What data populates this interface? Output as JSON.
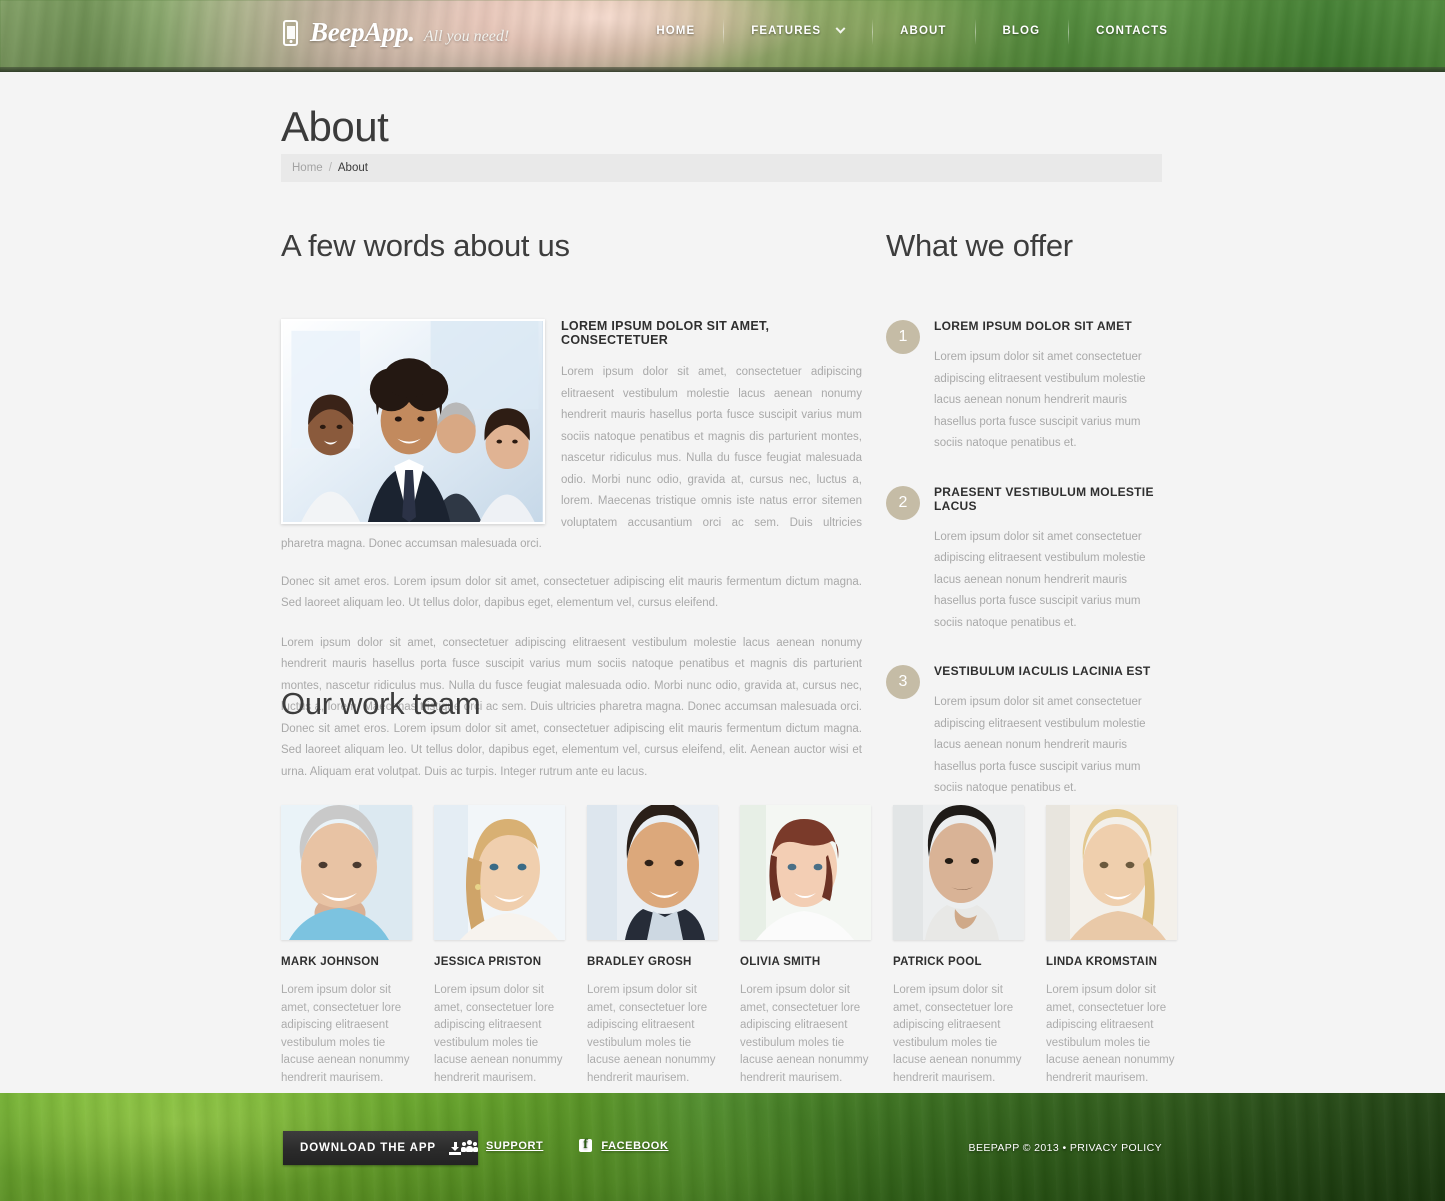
{
  "header": {
    "logo_name": "BeepApp.",
    "logo_tagline": "All you need!",
    "logo_icon": "smartphone-icon",
    "nav": [
      {
        "label": "HOME",
        "has_dropdown": false
      },
      {
        "label": "FEATURES",
        "has_dropdown": true
      },
      {
        "label": "ABOUT",
        "has_dropdown": false
      },
      {
        "label": "BLOG",
        "has_dropdown": false
      },
      {
        "label": "CONTACTS",
        "has_dropdown": false
      }
    ]
  },
  "page": {
    "title": "About",
    "breadcrumb": {
      "home": "Home",
      "separator": "/",
      "current": "About"
    }
  },
  "about": {
    "heading": "A few words about us",
    "subheading": "LOREM IPSUM DOLOR SIT AMET, CONSECTETUER",
    "paragraph_1": "Lorem ipsum dolor sit amet, consectetuer adipiscing elitraesent vestibulum molestie lacus aenean nonumy hendrerit mauris hasellus porta fusce suscipit varius mum sociis natoque penatibus et magnis dis parturient montes, nascetur ridiculus mus. Nulla du fusce feugiat malesuada odio. Morbi nunc odio, gravida at, cursus nec, luctus a, lorem. Maecenas tristique omnis iste natus error sitemen voluptatem accusantium orci ac sem. Duis ultricies pharetra magna. Donec accumsan malesuada orci.",
    "paragraph_2": "Donec sit amet eros. Lorem ipsum dolor sit amet, consectetuer adipiscing elit mauris fermentum dictum magna. Sed laoreet aliquam leo. Ut tellus dolor, dapibus eget, elementum vel, cursus eleifend.",
    "paragraph_3": "Lorem ipsum dolor sit amet, consectetuer adipiscing elitraesent vestibulum molestie lacus aenean nonumy hendrerit mauris hasellus porta fusce suscipit varius mum sociis natoque penatibus et magnis dis parturient montes, nascetur ridiculus mus. Nulla du fusce feugiat malesuada odio. Morbi nunc odio, gravida at, cursus nec, luctus a, lorem. Maecenas tristique orci ac sem. Duis ultricies pharetra magna. Donec accumsan malesuada orci. Donec sit amet eros. Lorem ipsum dolor sit amet, consectetuer adipiscing elit mauris fermentum dictum magna. Sed laoreet aliquam leo. Ut tellus dolor, dapibus eget, elementum vel, cursus eleifend, elit. Aenean auctor wisi et urna. Aliquam erat volutpat. Duis ac turpis. Integer rutrum ante eu lacus.",
    "image_alt": "business-team-photo"
  },
  "offer": {
    "heading": "What we offer",
    "items": [
      {
        "number": "1",
        "title": "LOREM IPSUM DOLOR SIT AMET",
        "text": "Lorem ipsum dolor sit amet consectetuer adipiscing elitraesent vestibulum molestie lacus aenean nonum hendrerit mauris hasellus porta fusce suscipit varius mum sociis natoque penatibus et."
      },
      {
        "number": "2",
        "title": "PRAESENT VESTIBULUM MOLESTIE LACUS",
        "text": "Lorem ipsum dolor sit amet consectetuer adipiscing elitraesent vestibulum molestie lacus aenean nonum hendrerit mauris hasellus porta fusce suscipit varius mum sociis natoque penatibus et."
      },
      {
        "number": "3",
        "title": "VESTIBULUM IACULIS LACINIA EST",
        "text": "Lorem ipsum dolor sit amet consectetuer adipiscing elitraesent vestibulum molestie lacus aenean nonum hendrerit mauris hasellus porta fusce suscipit varius mum sociis natoque penatibus et."
      }
    ]
  },
  "team": {
    "heading": "Our work team",
    "members": [
      {
        "name": "MARK JOHNSON",
        "bio": "Lorem ipsum dolor sit amet, consectetuer lore adipiscing elitraesent vestibulum moles tie lacuse aenean nonummy hendrerit maurisem."
      },
      {
        "name": "JESSICA PRISTON",
        "bio": "Lorem ipsum dolor sit amet, consectetuer lore adipiscing elitraesent vestibulum moles tie lacuse aenean nonummy hendrerit maurisem."
      },
      {
        "name": "BRADLEY GROSH",
        "bio": "Lorem ipsum dolor sit amet, consectetuer lore adipiscing elitraesent vestibulum moles tie lacuse aenean nonummy hendrerit maurisem."
      },
      {
        "name": "OLIVIA SMITH",
        "bio": "Lorem ipsum dolor sit amet, consectetuer lore adipiscing elitraesent vestibulum moles tie lacuse aenean nonummy hendrerit maurisem."
      },
      {
        "name": "PATRICK POOL",
        "bio": "Lorem ipsum dolor sit amet, consectetuer lore adipiscing elitraesent vestibulum moles tie lacuse aenean nonummy hendrerit maurisem."
      },
      {
        "name": "LINDA KROMSTAIN",
        "bio": "Lorem ipsum dolor sit amet, consectetuer lore adipiscing elitraesent vestibulum moles tie lacuse aenean nonummy hendrerit maurisem."
      }
    ]
  },
  "footer": {
    "download_label": "DOWNLOAD THE APP",
    "download_icon": "download-icon",
    "links": [
      {
        "label": "SUPPORT",
        "icon": "users-icon"
      },
      {
        "label": "FACEBOOK",
        "icon": "facebook-icon"
      }
    ],
    "copyright": "BEEPAPP © 2013 • PRIVACY POLICY"
  },
  "colors": {
    "accent_green": "#4f8a38",
    "number_badge": "#c5bca6",
    "body_text": "#a9a9a9",
    "heading_text": "#3d3d3d",
    "breadcrumb_bg": "#e9e9e9",
    "page_bg": "#f4f4f4",
    "button_dark": "#2b2b2b"
  }
}
